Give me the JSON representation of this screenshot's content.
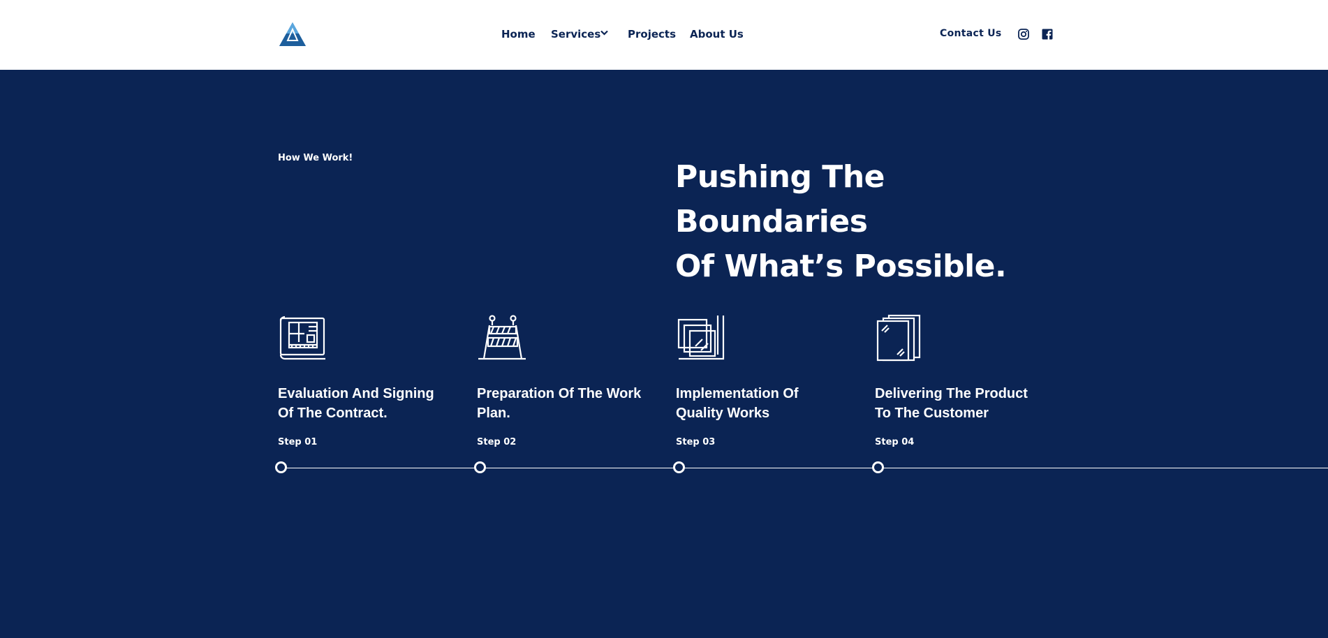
{
  "colors": {
    "navy": "#0b2454",
    "white": "#ffffff",
    "logo_blue": "#2f7fc0"
  },
  "header": {
    "nav": [
      {
        "label": "Home"
      },
      {
        "label": "Services"
      },
      {
        "label": "Projects"
      },
      {
        "label": "About Us"
      }
    ],
    "active_nav": "About Us",
    "contact_label": "Contact Us",
    "social_icons": [
      "instagram-icon",
      "facebook-icon"
    ]
  },
  "section": {
    "eyebrow": "How We Work!",
    "headline_line1": "Pushing The Boundaries",
    "headline_line2": "Of What’s Possible.",
    "steps": [
      {
        "icon": "blueprint-icon",
        "title_line1": "Evaluation And Signing",
        "title_line2": "Of The Contract.",
        "label": "Step 01"
      },
      {
        "icon": "construction-barrier-icon",
        "title_line1": "Preparation Of The Work",
        "title_line2": "Plan.",
        "label": "Step 02"
      },
      {
        "icon": "layered-panels-icon",
        "title_line1": "Implementation Of",
        "title_line2": "Quality Works",
        "label": "Step 03"
      },
      {
        "icon": "glass-panels-icon",
        "title_line1": "Delivering The Product",
        "title_line2": "To The Customer",
        "label": "Step 04"
      }
    ]
  }
}
